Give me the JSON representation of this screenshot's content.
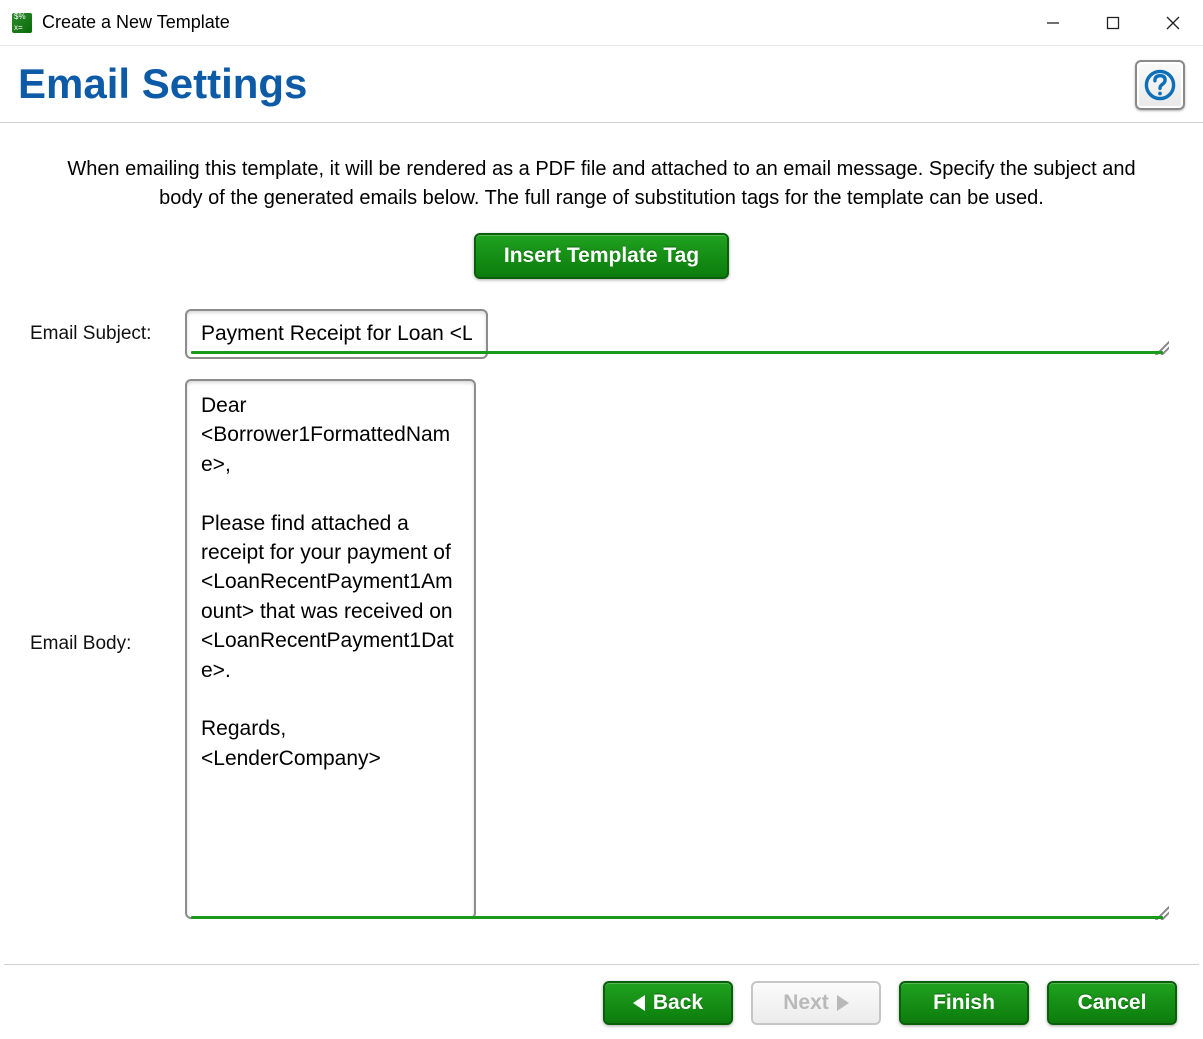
{
  "window": {
    "title": "Create a New Template"
  },
  "page": {
    "heading": "Email Settings",
    "intro": "When emailing this template, it will be rendered as a PDF file and attached to an email message. Specify the subject and body of the generated emails below. The full range of substitution tags for the template can be used."
  },
  "buttons": {
    "insert_tag": "Insert Template Tag",
    "back": "Back",
    "next": "Next",
    "finish": "Finish",
    "cancel": "Cancel"
  },
  "labels": {
    "subject": "Email Subject:",
    "body": "Email Body:"
  },
  "form": {
    "subject_value": "Payment Receipt for Loan <LoanAccountNumber>",
    "body_value": "Dear <Borrower1FormattedName>,\n\nPlease find attached a receipt for your payment of <LoanRecentPayment1Amount> that was received on <LoanRecentPayment1Date>.\n\nRegards,\n<LenderCompany>"
  }
}
